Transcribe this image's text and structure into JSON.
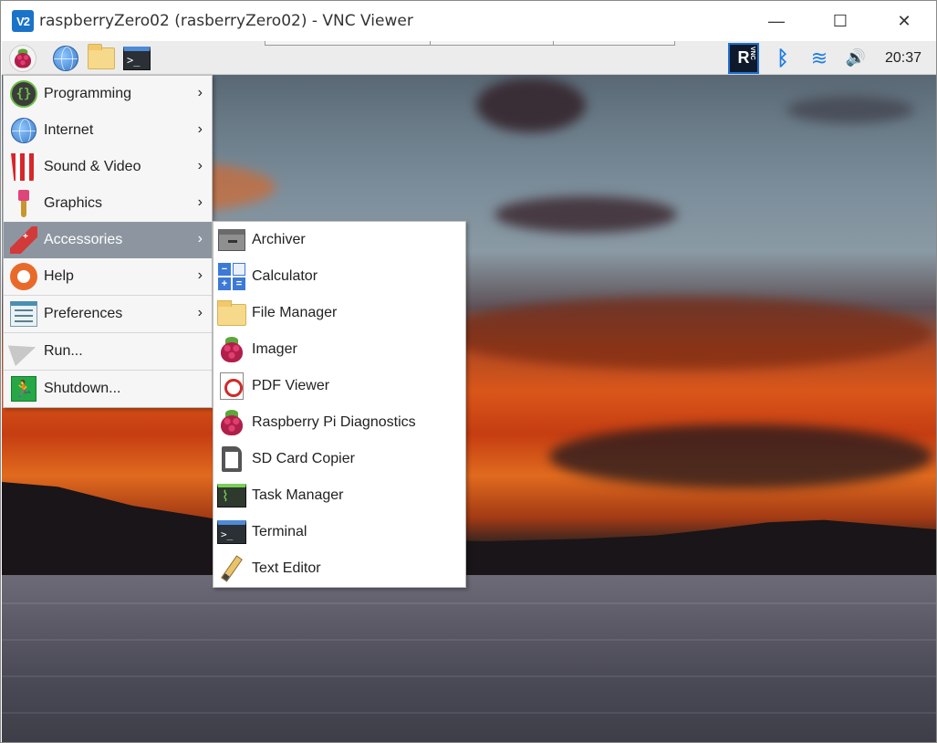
{
  "window": {
    "app_icon_text": "V2",
    "title": "raspberryZero02 (rasberryZero02) - VNC Viewer",
    "minimize": "—",
    "maximize": "☐",
    "close": "✕"
  },
  "panel": {
    "tray_vnc_letter": "R",
    "tray_vnc_small": "VNC",
    "clock": "20:37"
  },
  "menu": {
    "items": [
      {
        "label": "Programming",
        "icon": "programming-icon"
      },
      {
        "label": "Internet",
        "icon": "globe-icon"
      },
      {
        "label": "Sound & Video",
        "icon": "popcorn-icon"
      },
      {
        "label": "Graphics",
        "icon": "paintbrush-icon"
      },
      {
        "label": "Accessories",
        "icon": "pocketknife-icon"
      },
      {
        "label": "Help",
        "icon": "lifebuoy-icon"
      },
      {
        "label": "Preferences",
        "icon": "preferences-icon"
      },
      {
        "label": "Run...",
        "icon": "paper-plane-icon"
      },
      {
        "label": "Shutdown...",
        "icon": "exit-icon"
      }
    ],
    "arrow": "›"
  },
  "submenu": {
    "items": [
      {
        "label": "Archiver"
      },
      {
        "label": "Calculator"
      },
      {
        "label": "File Manager"
      },
      {
        "label": "Imager"
      },
      {
        "label": "PDF Viewer"
      },
      {
        "label": "Raspberry Pi Diagnostics"
      },
      {
        "label": "SD Card Copier"
      },
      {
        "label": "Task Manager"
      },
      {
        "label": "Terminal"
      },
      {
        "label": "Text Editor"
      }
    ]
  },
  "icons": {
    "terminal_prompt": ">_",
    "programming_glyph": "{}",
    "shutdown_glyph": "🏃",
    "bluetooth_glyph": "ᛒ",
    "wifi_glyph": "≋",
    "volume_glyph": "🔊",
    "calc_minus": "−",
    "calc_equals": "=",
    "calc_plus": "+",
    "calc_blank": ""
  }
}
